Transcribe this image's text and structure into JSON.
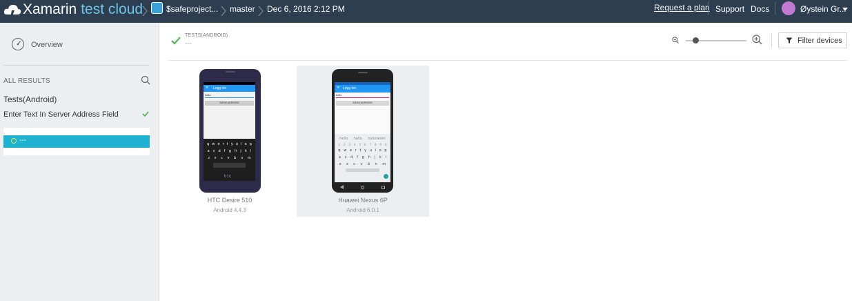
{
  "topbar": {
    "brand_main": "Xamarin",
    "brand_sub": "test cloud",
    "app_name": "$safeproject...",
    "branch": "master",
    "run_date": "Dec 6, 2016 2:12 PM",
    "request_plan": "Request a plan",
    "support": "Support",
    "docs": "Docs",
    "user_name": "Øystein Gr...",
    "colors": {
      "bar": "#2c3e50",
      "brand_accent": "#6fc3e8"
    }
  },
  "sidebar": {
    "overview_label": "Overview",
    "all_results_label": "ALL RESULTS",
    "suite_title": "Tests(Android)",
    "step_label": "Enter Text In Server Address Field",
    "result_item": "---",
    "colors": {
      "selected": "#1fb2d0",
      "pass": "#4caf50"
    }
  },
  "main": {
    "tests_label": "TESTS(ANDROID)",
    "tests_value": "---",
    "filter_label": "Filter devices",
    "zoom_level": 0.17,
    "devices": [
      {
        "name": "HTC Desire 510",
        "os": "Android 4.4.3",
        "selected": false,
        "screen_title": "Logg inn",
        "screen_input": "hello",
        "screen_button": "SJEKK ADRESSE",
        "keys_row1": [
          "q",
          "w",
          "e",
          "r",
          "t",
          "y",
          "u",
          "i",
          "o",
          "p"
        ],
        "keys_row2": [
          "a",
          "s",
          "d",
          "f",
          "g",
          "h",
          "j",
          "k",
          "l"
        ],
        "keys_row3": [
          "z",
          "x",
          "c",
          "v",
          "b",
          "n",
          "m"
        ],
        "brand_mark": "htc"
      },
      {
        "name": "Huawei Nexus 6P",
        "os": "Android 6.0.1",
        "selected": true,
        "screen_title": "Logg inn",
        "screen_input": "hello",
        "screen_button": "SJEKK ADRESSE",
        "suggestions": [
          "hello",
          "hello",
          "halloween"
        ],
        "keys_row0": [
          "1",
          "2",
          "3",
          "4",
          "5",
          "6",
          "7",
          "8",
          "9",
          "0"
        ],
        "keys_row1": [
          "q",
          "w",
          "e",
          "r",
          "t",
          "y",
          "u",
          "i",
          "o",
          "p"
        ],
        "keys_row2": [
          "a",
          "s",
          "d",
          "f",
          "g",
          "h",
          "j",
          "k",
          "l"
        ],
        "keys_row3": [
          "z",
          "x",
          "c",
          "v",
          "b",
          "n",
          "m"
        ]
      }
    ]
  }
}
